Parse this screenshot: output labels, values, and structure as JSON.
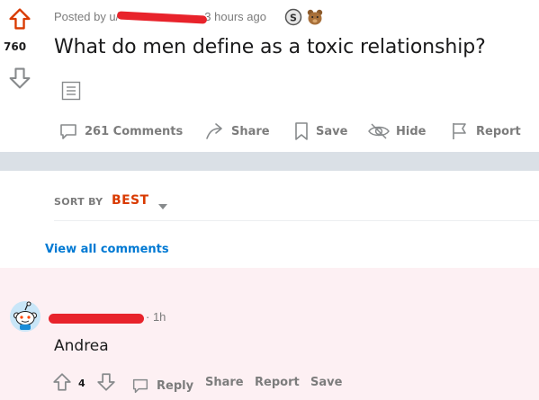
{
  "post": {
    "score": "760",
    "posted_by_prefix": "Posted by u/",
    "time_ago": "3 hours ago",
    "title": "What do men define as a toxic relationship?",
    "awards": [
      {
        "name": "silver-award-icon",
        "label": "S"
      },
      {
        "name": "bronze-award-icon",
        "label": ""
      }
    ]
  },
  "actions": {
    "comments": "261 Comments",
    "share": "Share",
    "save": "Save",
    "hide": "Hide",
    "report": "Report"
  },
  "sort": {
    "label": "SORT BY",
    "value": "BEST"
  },
  "view_all_comments": "View all comments",
  "comment": {
    "time": "· 1h",
    "body": "Andrea",
    "score": "4",
    "reply": "Reply",
    "share": "Share",
    "report": "Report",
    "save": "Save"
  },
  "colors": {
    "upvote_active": "#d93a00",
    "accent_blue": "#0079d3",
    "sort_orange": "#d93a00",
    "band": "#dae0e6",
    "comment_highlight": "#fdf0f3",
    "redaction": "#e8232b"
  }
}
